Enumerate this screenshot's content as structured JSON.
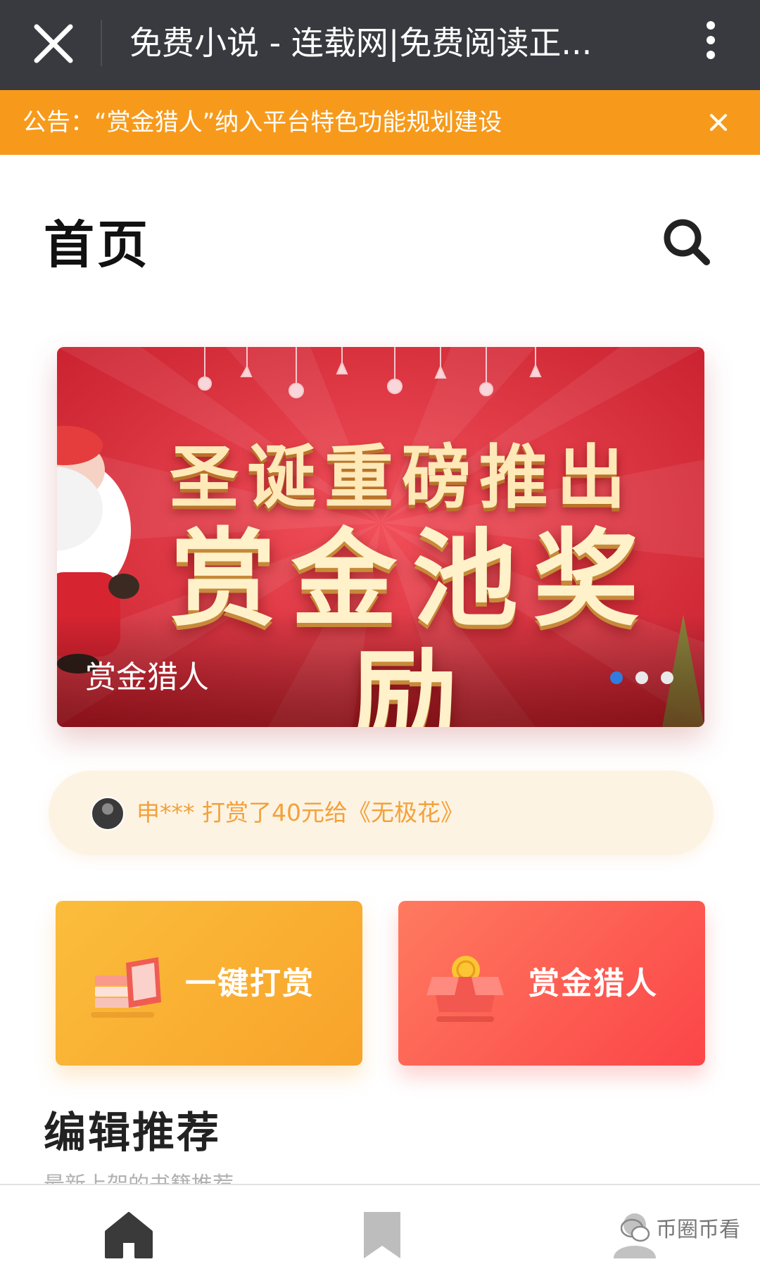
{
  "titlebar": {
    "title": "免费小说 - 连载网|免费阅读正...",
    "close_icon": "close-icon",
    "more_icon": "more-vertical-icon"
  },
  "announcement": {
    "text": "公告：“赏金猎人”纳入平台特色功能规划建设",
    "close_icon": "close-icon",
    "color": "#f79a1b"
  },
  "header": {
    "title": "首页",
    "search_icon": "search-icon"
  },
  "banner": {
    "headline": "圣诞重磅推出",
    "mainline": "赏金池奖励",
    "caption": "赏金猎人",
    "slides_total": 3,
    "active_slide": 1,
    "color": "#d92d3a"
  },
  "tip": {
    "text": "申*** 打赏了40元给《无极花》",
    "color": "#f3a13a"
  },
  "actions": [
    {
      "label": "一键打赏",
      "icon": "book-stack-icon",
      "color": "#f9ad30"
    },
    {
      "label": "赏金猎人",
      "icon": "treasure-box-icon",
      "color": "#fd5d52"
    }
  ],
  "section": {
    "title": "编辑推荐",
    "subtitle": "最新上架的书籍推荐"
  },
  "bottom_nav": {
    "items": [
      {
        "icon": "home-icon",
        "active": true
      },
      {
        "icon": "bookmark-icon",
        "active": false
      },
      {
        "icon": "user-icon",
        "active": false
      }
    ],
    "watermark": "币圈币看"
  }
}
